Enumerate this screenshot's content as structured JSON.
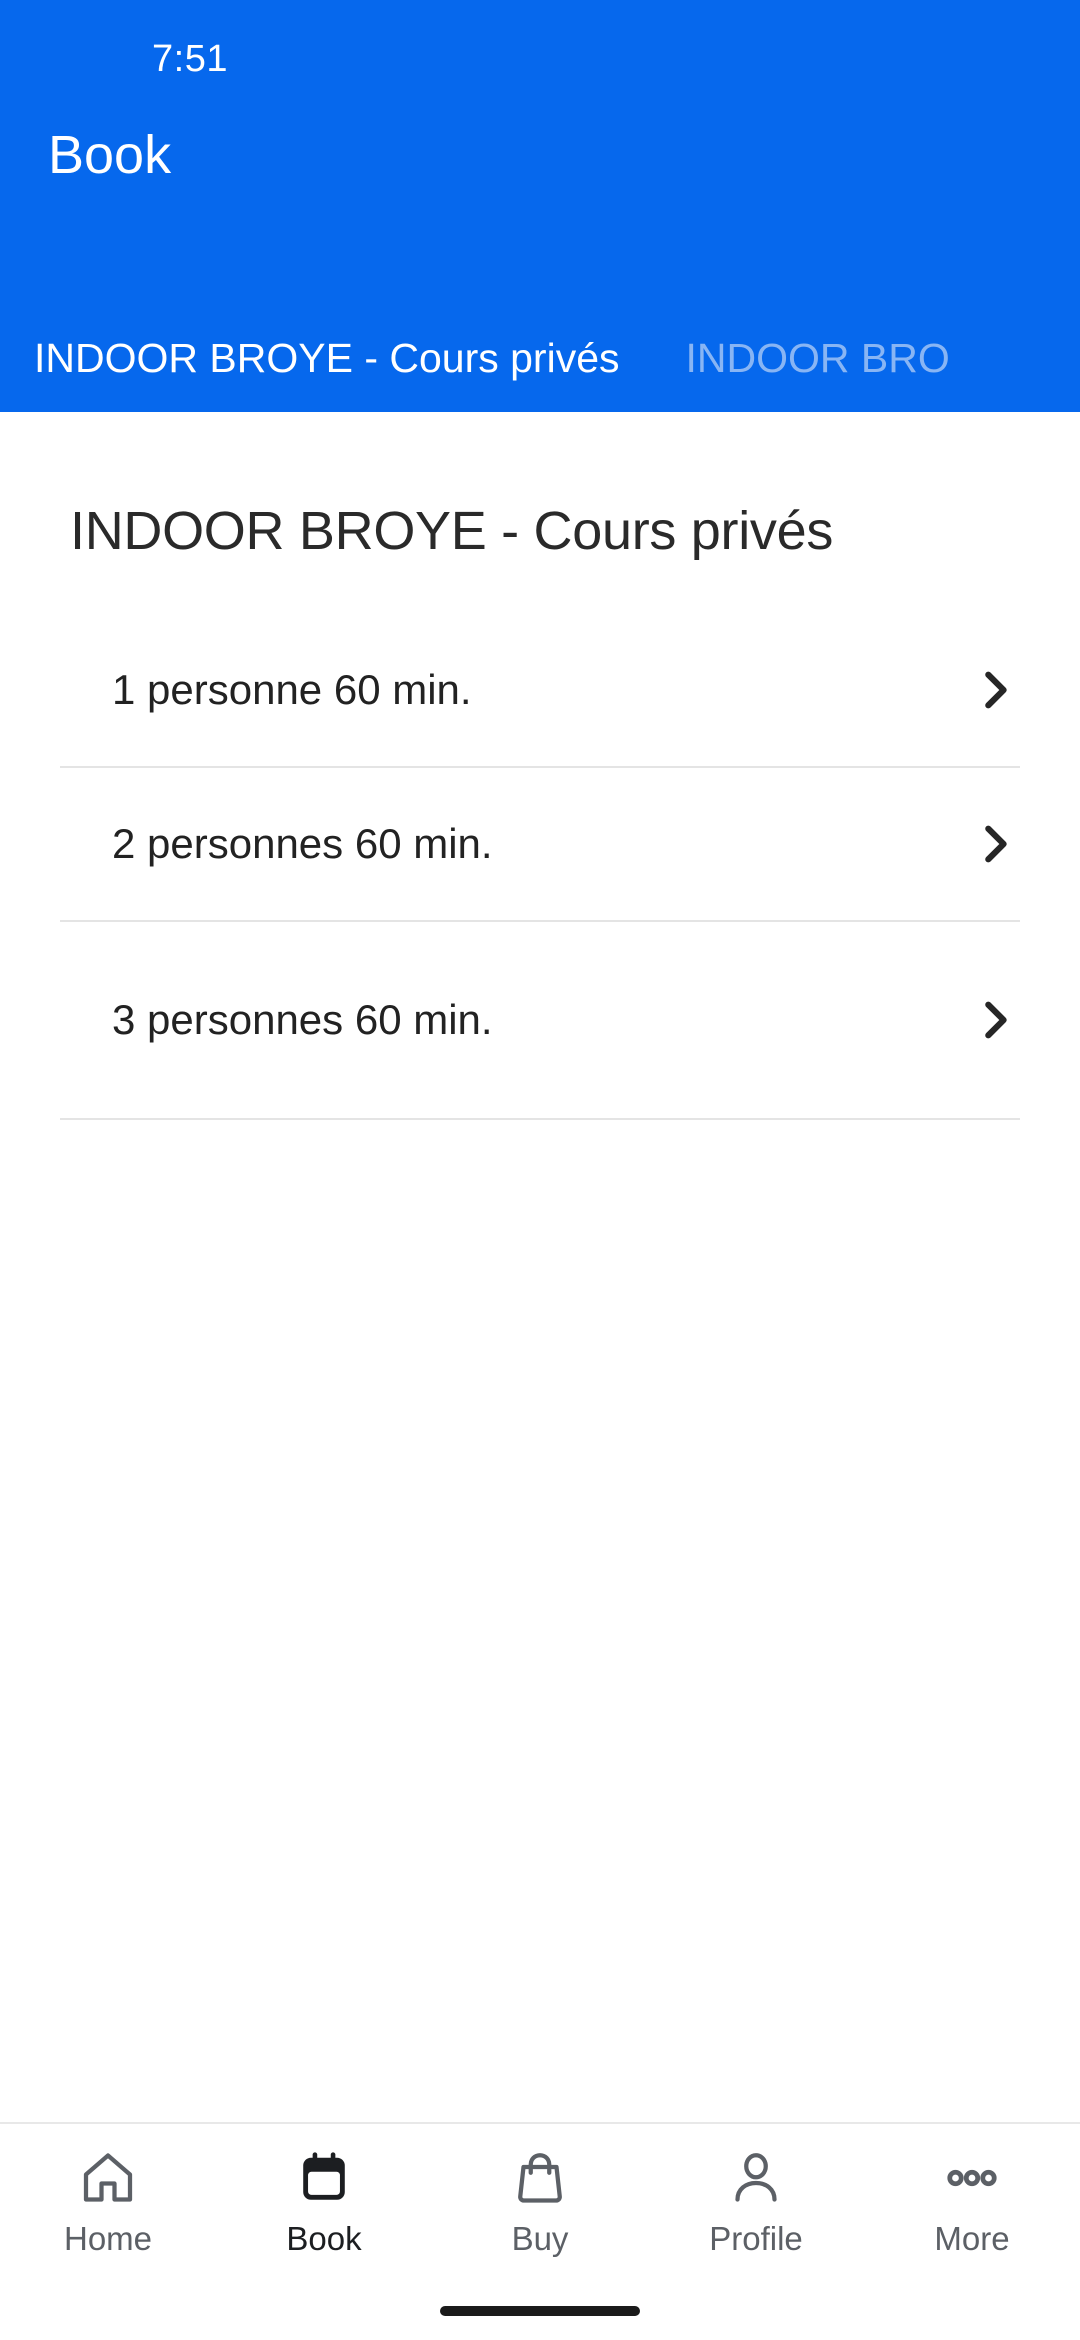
{
  "status_bar": {
    "time": "7:51"
  },
  "header": {
    "app_title": "Book",
    "background_color": "#0668ED",
    "tabs": [
      {
        "label": "INDOOR BROYE - Cours privés",
        "active": true
      },
      {
        "label": "INDOOR BRO",
        "active": false
      }
    ]
  },
  "main": {
    "page_title": "INDOOR BROYE - Cours privés",
    "items": [
      {
        "label": "1 personne 60 min.",
        "chevron": "chevron-right-icon"
      },
      {
        "label": "2 personnes 60 min.",
        "chevron": "chevron-right-icon"
      },
      {
        "label": "3 personnes 60 min.",
        "chevron": "chevron-right-icon"
      }
    ]
  },
  "bottom_nav": {
    "items": [
      {
        "label": "Home",
        "icon": "home-icon",
        "active": false
      },
      {
        "label": "Book",
        "icon": "calendar-icon",
        "active": true
      },
      {
        "label": "Buy",
        "icon": "shopping-bag-icon",
        "active": false
      },
      {
        "label": "Profile",
        "icon": "person-icon",
        "active": false
      },
      {
        "label": "More",
        "icon": "ellipsis-icon",
        "active": false
      }
    ],
    "active_color": "#1C1E21",
    "inactive_color": "#5C6066"
  }
}
